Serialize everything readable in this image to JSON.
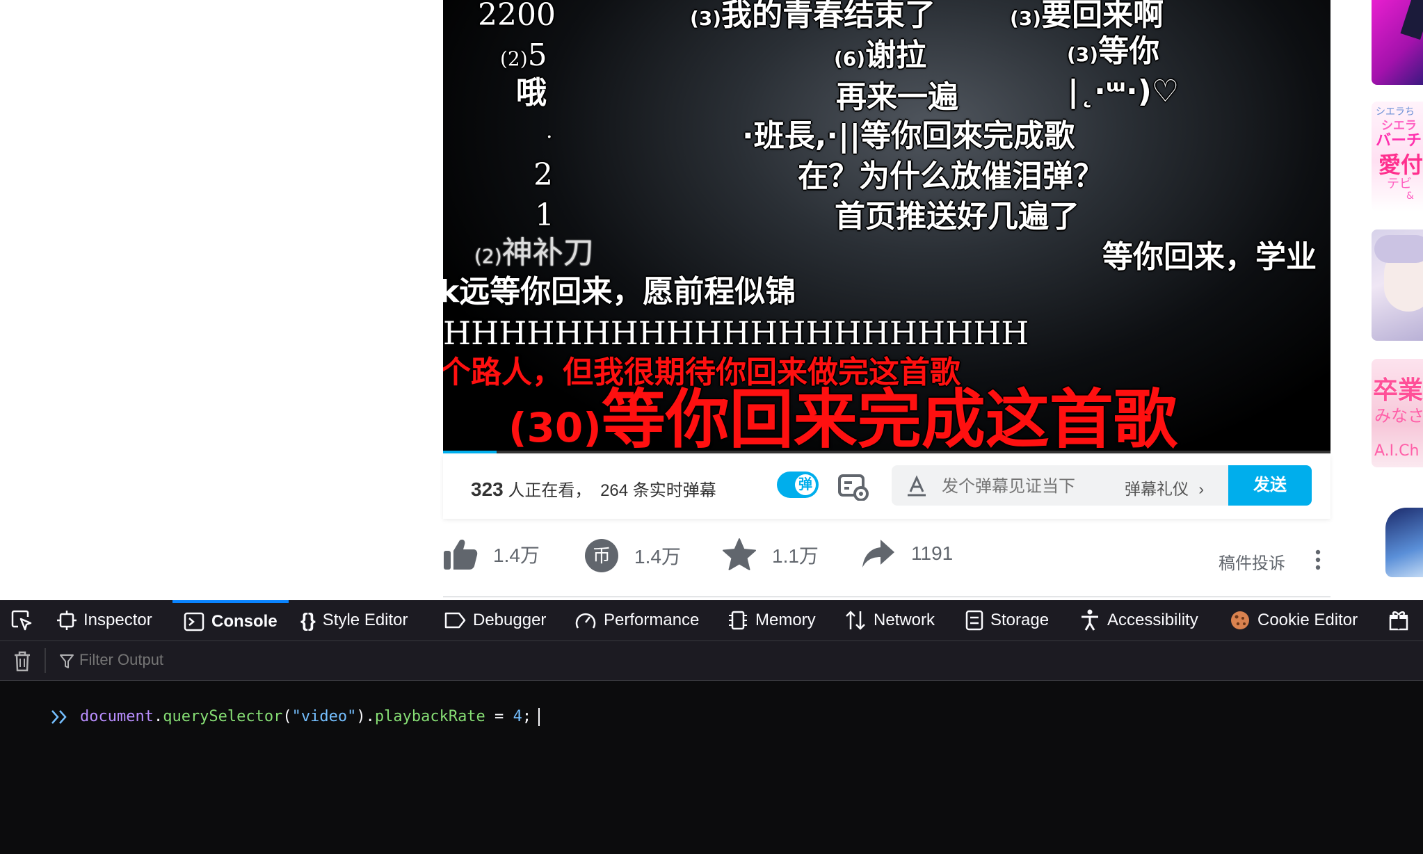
{
  "video": {
    "danmaku": [
      {
        "count": "",
        "text": "2200"
      },
      {
        "count": "(3)",
        "text": "我的青春结束了"
      },
      {
        "count": "(3)",
        "text": "要回来啊"
      },
      {
        "count": "(2)",
        "text": "5"
      },
      {
        "count": "(6)",
        "text": "谢拉"
      },
      {
        "count": "(3)",
        "text": "等你"
      },
      {
        "count": "",
        "text": "哦"
      },
      {
        "count": "",
        "text": "再来一遍"
      },
      {
        "count": "",
        "text": "|˛·ᵚ·)♡"
      },
      {
        "count": "",
        "text": "."
      },
      {
        "count": "",
        "text": "·班長,·||等你回來完成歌"
      },
      {
        "count": "",
        "text": "2"
      },
      {
        "count": "",
        "text": "在？为什么放催泪弹？"
      },
      {
        "count": "",
        "text": "1"
      },
      {
        "count": "",
        "text": "首页推送好几遍了"
      },
      {
        "count": "(2)",
        "text": "神补刀"
      },
      {
        "count": "",
        "text": "等你回来，学业"
      },
      {
        "count": "",
        "text": "k远等你回来，愿前程似锦"
      },
      {
        "count": "",
        "text": "HHHHHHHHHHHHHHHHHHHHH"
      },
      {
        "count": "",
        "text": "个路人，但我很期待你回来做完这首歌"
      },
      {
        "count": "(30)",
        "text": "等你回来完成这首歌"
      }
    ],
    "progress_fraction": 0.06
  },
  "sendbar": {
    "viewer_count": "323",
    "viewer_text": "人正在看，",
    "danmaku_count_text": "264 条实时弹幕",
    "toggle_label": "弹",
    "input_placeholder": "发个弹幕见证当下",
    "etiquette_label": "弹幕礼仪",
    "send_label": "发送"
  },
  "actions": {
    "like_count": "1.4万",
    "coin_count": "1.4万",
    "coin_glyph": "币",
    "favorite_count": "1.1万",
    "share_count": "1191",
    "complaint_label": "稿件投诉"
  },
  "sidebar": {
    "thumb_texts": [
      "シエラち",
      "シエラ",
      "バーチ",
      "愛付",
      "テビ",
      "&",
      "卒業",
      "みなさ",
      "A.I.Ch"
    ]
  },
  "devtools": {
    "tabs": [
      "Inspector",
      "Console",
      "Style Editor",
      "Debugger",
      "Performance",
      "Memory",
      "Network",
      "Storage",
      "Accessibility",
      "Cookie Editor"
    ],
    "active_tab": "Console",
    "filter_placeholder": "Filter Output",
    "console_input": {
      "obj": "document",
      "dot1": ".",
      "method": "querySelector",
      "paren_open": "(",
      "arg": "\"video\"",
      "paren_close": ")",
      "dot2": ".",
      "prop": "playbackRate",
      "op": " = ",
      "value": "4",
      "semi": ";"
    }
  },
  "colors": {
    "accent": "#00aeec",
    "danmaku_red": "#ff1010",
    "devtools_bg": "#0c0c0d",
    "devtools_active": "#0a84ff"
  }
}
